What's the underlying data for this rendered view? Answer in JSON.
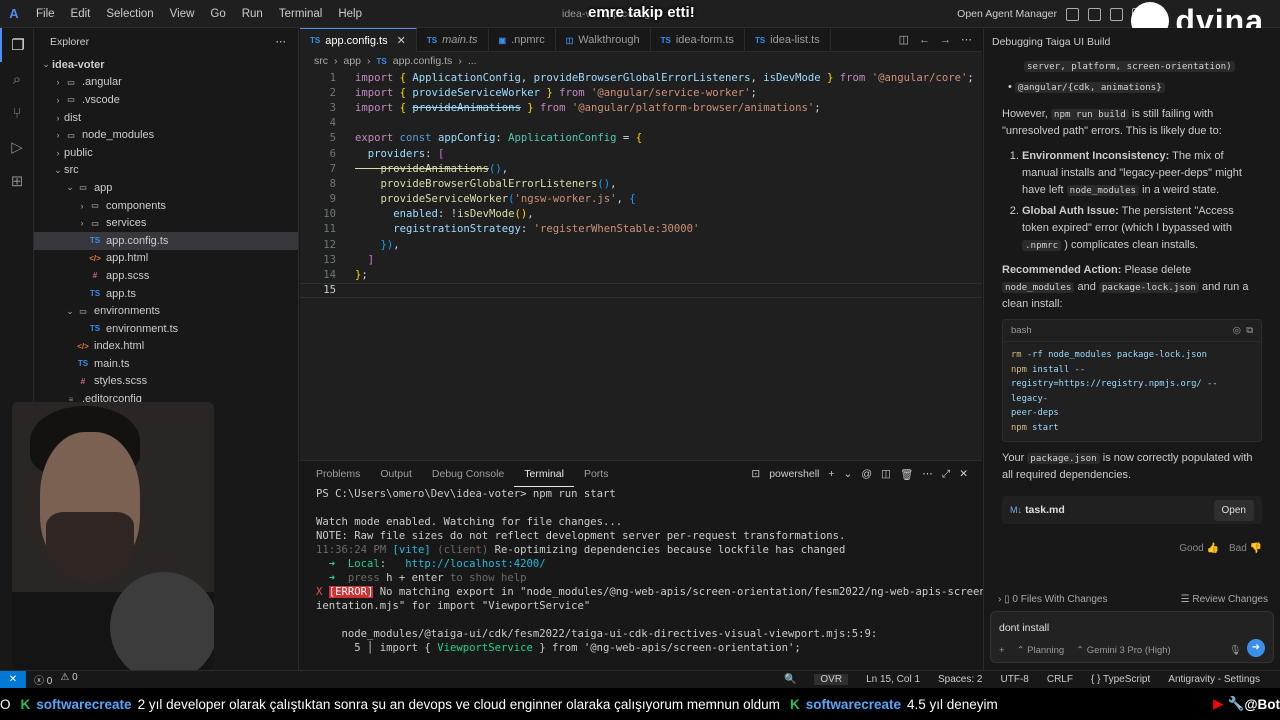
{
  "titlebar": {
    "menu": [
      "File",
      "Edit",
      "Selection",
      "View",
      "Go",
      "Run",
      "Terminal",
      "Help"
    ],
    "window_title": "idea-v... app.config.ts",
    "overlay": "emre takip etti!",
    "agent_manager": "Open Agent Manager",
    "brand": "dvina"
  },
  "sidebar": {
    "header": "Explorer",
    "rows": [
      {
        "label": "idea-voter",
        "indent": 0,
        "chev": "⌄",
        "icon": "",
        "cls": ""
      },
      {
        "label": ".angular",
        "indent": 1,
        "chev": "›",
        "icon": "▭",
        "cls": "folder"
      },
      {
        "label": ".vscode",
        "indent": 1,
        "chev": "›",
        "icon": "▭",
        "cls": "folder"
      },
      {
        "label": "dist",
        "indent": 1,
        "chev": "›",
        "icon": "",
        "cls": ""
      },
      {
        "label": "node_modules",
        "indent": 1,
        "chev": "›",
        "icon": "▭",
        "cls": "folder"
      },
      {
        "label": "public",
        "indent": 1,
        "chev": "›",
        "icon": "",
        "cls": ""
      },
      {
        "label": "src",
        "indent": 1,
        "chev": "⌄",
        "icon": "",
        "cls": ""
      },
      {
        "label": "app",
        "indent": 2,
        "chev": "⌄",
        "icon": "▭",
        "cls": "folder"
      },
      {
        "label": "components",
        "indent": 3,
        "chev": "›",
        "icon": "▭",
        "cls": "folder"
      },
      {
        "label": "services",
        "indent": 3,
        "chev": "›",
        "icon": "▭",
        "cls": "folder"
      },
      {
        "label": "app.config.ts",
        "indent": 3,
        "chev": "",
        "icon": "TS",
        "cls": "ts",
        "selected": true
      },
      {
        "label": "app.html",
        "indent": 3,
        "chev": "",
        "icon": "</>",
        "cls": "html"
      },
      {
        "label": "app.scss",
        "indent": 3,
        "chev": "",
        "icon": "#",
        "cls": "scss"
      },
      {
        "label": "app.ts",
        "indent": 3,
        "chev": "",
        "icon": "TS",
        "cls": "ts"
      },
      {
        "label": "environments",
        "indent": 2,
        "chev": "⌄",
        "icon": "▭",
        "cls": "folder"
      },
      {
        "label": "environment.ts",
        "indent": 3,
        "chev": "",
        "icon": "TS",
        "cls": "ts"
      },
      {
        "label": "index.html",
        "indent": 2,
        "chev": "",
        "icon": "</>",
        "cls": "html"
      },
      {
        "label": "main.ts",
        "indent": 2,
        "chev": "",
        "icon": "TS",
        "cls": "ts"
      },
      {
        "label": "styles.scss",
        "indent": 2,
        "chev": "",
        "icon": "#",
        "cls": "scss"
      },
      {
        "label": ".editorconfig",
        "indent": 1,
        "chev": "",
        "icon": "≡",
        "cls": "cfg"
      }
    ]
  },
  "editor": {
    "tabs": [
      {
        "label": "app.config.ts",
        "icon": "TS",
        "active": true
      },
      {
        "label": "main.ts",
        "icon": "TS",
        "active": false
      },
      {
        "label": ".npmrc",
        "icon": "▣",
        "active": false
      },
      {
        "label": "Walkthrough",
        "icon": "◫",
        "active": false
      },
      {
        "label": "idea-form.ts",
        "icon": "TS",
        "active": false
      },
      {
        "label": "idea-list.ts",
        "icon": "TS",
        "active": false
      }
    ],
    "breadcrumb": [
      "src",
      "app",
      "app.config.ts",
      "..."
    ],
    "lines": [
      [
        [
          "import ",
          "kw"
        ],
        [
          "{ ",
          "y"
        ],
        [
          "ApplicationConfig",
          "v"
        ],
        [
          ", ",
          "p"
        ],
        [
          "provideBrowserGlobalErrorListeners",
          "v"
        ],
        [
          ", ",
          "p"
        ],
        [
          "isDevMode",
          "v"
        ],
        [
          " } ",
          "y"
        ],
        [
          "from ",
          "kw"
        ],
        [
          "'@angular/core'",
          "s"
        ],
        [
          ";",
          "p"
        ]
      ],
      [
        [
          "import ",
          "kw"
        ],
        [
          "{ ",
          "y"
        ],
        [
          "provideServiceWorker",
          "v"
        ],
        [
          " } ",
          "y"
        ],
        [
          "from ",
          "kw"
        ],
        [
          "'@angular/service-worker'",
          "s"
        ],
        [
          ";",
          "p"
        ]
      ],
      [
        [
          "import ",
          "kw"
        ],
        [
          "{ ",
          "y"
        ],
        [
          "provideAnimations",
          "v strike"
        ],
        [
          " } ",
          "y"
        ],
        [
          "from ",
          "kw"
        ],
        [
          "'@angular/platform-browser/animations'",
          "s"
        ],
        [
          ";",
          "p"
        ]
      ],
      [],
      [
        [
          "export ",
          "kw"
        ],
        [
          "const ",
          "k"
        ],
        [
          "appConfig",
          "v"
        ],
        [
          ": ",
          "p"
        ],
        [
          "ApplicationConfig",
          "t"
        ],
        [
          " = ",
          "p"
        ],
        [
          "{",
          "y"
        ]
      ],
      [
        [
          "  providers",
          "v"
        ],
        [
          ": ",
          "p"
        ],
        [
          "[",
          "pk"
        ]
      ],
      [
        [
          "    provideAnimations",
          "f strike"
        ],
        [
          "()",
          "bl"
        ],
        [
          ",",
          "p"
        ]
      ],
      [
        [
          "    provideBrowserGlobalErrorListeners",
          "f"
        ],
        [
          "()",
          "bl"
        ],
        [
          ",",
          "p"
        ]
      ],
      [
        [
          "    provideServiceWorker",
          "f"
        ],
        [
          "(",
          "bl"
        ],
        [
          "'ngsw-worker.js'",
          "s"
        ],
        [
          ", ",
          "p"
        ],
        [
          "{",
          "bl"
        ]
      ],
      [
        [
          "      enabled",
          "v"
        ],
        [
          ": ",
          "p"
        ],
        [
          "!",
          "p"
        ],
        [
          "isDevMode",
          "f"
        ],
        [
          "()",
          "y"
        ],
        [
          ",",
          "p"
        ]
      ],
      [
        [
          "      registrationStrategy",
          "v"
        ],
        [
          ": ",
          "p"
        ],
        [
          "'registerWhenStable:30000'",
          "s"
        ]
      ],
      [
        [
          "    }",
          "bl"
        ],
        [
          ")",
          "bl"
        ],
        [
          ",",
          "p"
        ]
      ],
      [
        [
          "  ]",
          "pk"
        ]
      ],
      [
        [
          "}",
          "y"
        ],
        [
          ";",
          "p"
        ]
      ],
      []
    ]
  },
  "panel": {
    "tabs": [
      "Problems",
      "Output",
      "Debug Console",
      "Terminal",
      "Ports"
    ],
    "active_tab": "Terminal",
    "shell": "powershell",
    "terminal": [
      [
        [
          "PS C:\\Users\\omero\\Dev\\idea-voter> ",
          ""
        ],
        [
          "npm run start",
          ""
        ]
      ],
      [],
      [
        [
          "Watch mode enabled. Watching for file changes...",
          ""
        ]
      ],
      [
        [
          "NOTE: Raw file sizes do not reflect development server per-request transformations.",
          ""
        ]
      ],
      [
        [
          "11:36:24 PM ",
          "dim"
        ],
        [
          "[vite] ",
          "cyan"
        ],
        [
          "(client) ",
          "dim"
        ],
        [
          "Re-optimizing dependencies because lockfile has changed",
          ""
        ]
      ],
      [
        [
          "  ➜  ",
          "green"
        ],
        [
          "Local",
          "green"
        ],
        [
          ":   ",
          ""
        ],
        [
          "http://localhost:",
          "cyan"
        ],
        [
          "4200",
          "cyan"
        ],
        [
          "/",
          "cyan"
        ]
      ],
      [
        [
          "  ➜  ",
          "green"
        ],
        [
          "press ",
          "dim"
        ],
        [
          "h + enter ",
          ""
        ],
        [
          "to show help",
          "dim"
        ]
      ],
      [
        [
          "X ",
          "red"
        ],
        [
          "[ERROR]",
          "redbg"
        ],
        [
          " No matching export in \"node_modules/@ng-web-apis/screen-orientation/fesm2022/ng-web-apis-screen-or",
          ""
        ]
      ],
      [
        [
          "ientation.mjs\" for import \"ViewportService\"",
          ""
        ]
      ],
      [],
      [
        [
          "    node_modules/@taiga-ui/cdk/fesm2022/taiga-ui-cdk-directives-visual-viewport.mjs:5:9:",
          ""
        ]
      ],
      [
        [
          "      5 │ import { ",
          ""
        ],
        [
          "ViewportService",
          "green"
        ],
        [
          " } from '@ng-web-apis/screen-orientation';",
          ""
        ]
      ]
    ]
  },
  "agent": {
    "title": "Debugging Taiga UI Build",
    "top_code": "server, platform, screen-orientation)",
    "bullet_code": "@angular/{cdk, animations}",
    "p1_a": "However,",
    "p1_code": "npm run build",
    "p1_b": "is still failing with \"unresolved path\" errors. This is likely due to:",
    "items": [
      {
        "title": "Environment Inconsistency:",
        "text": "The mix of manual installs and \"legacy-peer-deps\" might have left",
        "code": "node_modules",
        "tail": "in a weird state."
      },
      {
        "title": "Global Auth Issue:",
        "text": "The persistent \"Access token expired\" error (which I bypassed with",
        "code": ".npmrc",
        "tail": ") complicates clean installs."
      }
    ],
    "rec_title": "Recommended Action:",
    "rec_a": "Please delete",
    "rec_code1": "node_modules",
    "rec_and": "and",
    "rec_code2": "package-lock.json",
    "rec_b": "and run a clean install:",
    "code_lang": "bash",
    "code_lines": [
      [
        [
          "rm",
          "c-cmd"
        ],
        [
          " -rf node_modules package-lock.json",
          "c-arg"
        ]
      ],
      [
        [
          "npm",
          "c-cmd"
        ],
        [
          " install --",
          "c-arg"
        ]
      ],
      [
        [
          "registry=https://registry.npmjs.org/ --legacy-",
          "c-arg"
        ]
      ],
      [
        [
          "peer-deps",
          "c-arg"
        ]
      ],
      [
        [
          "npm",
          "c-cmd"
        ],
        [
          " start",
          "c-arg"
        ]
      ]
    ],
    "done_a": "Your",
    "done_code": "package.json",
    "done_b": "is now correctly populated with all required dependencies.",
    "file_name": "task.md",
    "open_label": "Open",
    "good": "Good",
    "bad": "Bad",
    "changes_label": "0 Files With Changes",
    "review_label": "Review Changes",
    "input_value": "dont install",
    "planning": "Planning",
    "model": "Gemini 3 Pro (High)"
  },
  "status": {
    "errors": "0",
    "warnings": "0",
    "ovr": "OVR",
    "position": "Ln 15, Col 1",
    "spaces": "Spaces: 2",
    "encoding": "UTF-8",
    "eol": "CRLF",
    "language": "TypeScript",
    "settings": "Antigravity - Settings"
  },
  "ticker": {
    "lead": "O",
    "user1": "softwarecreate",
    "msg1": "2 yıl developer olarak çalıştıktan sonra şu an devops ve cloud enginner olaraka çalışıyorum memnun oldum",
    "user2": "softwarecreate",
    "msg2": "4.5 yıl deneyim",
    "tail": "@Bot"
  }
}
